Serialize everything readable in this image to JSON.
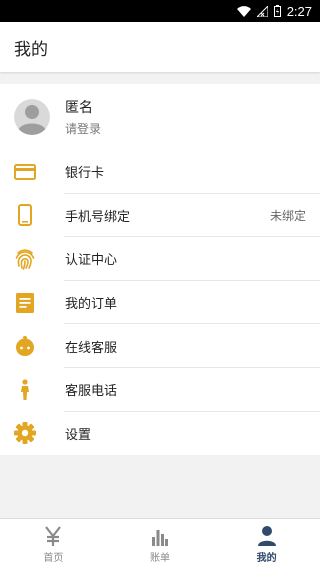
{
  "status_bar": {
    "time": "2:27"
  },
  "header": {
    "title": "我的"
  },
  "profile": {
    "name": "匿名",
    "subtitle": "请登录"
  },
  "menu": [
    {
      "label": "银行卡",
      "value": "",
      "icon": "bank-card-icon"
    },
    {
      "label": "手机号绑定",
      "value": "未绑定",
      "icon": "phone-icon"
    },
    {
      "label": "认证中心",
      "value": "",
      "icon": "fingerprint-icon"
    },
    {
      "label": "我的订单",
      "value": "",
      "icon": "order-icon"
    },
    {
      "label": "在线客服",
      "value": "",
      "icon": "customer-service-icon"
    },
    {
      "label": "客服电话",
      "value": "",
      "icon": "person-icon"
    },
    {
      "label": "设置",
      "value": "",
      "icon": "gear-icon"
    }
  ],
  "tabs": [
    {
      "label": "首页",
      "icon": "yen-icon",
      "active": false
    },
    {
      "label": "账单",
      "icon": "bar-chart-icon",
      "active": false
    },
    {
      "label": "我的",
      "icon": "user-icon",
      "active": true
    }
  ],
  "colors": {
    "accent": "#e3a622",
    "tab_active": "#2f4a6b",
    "tab_inactive": "#8a8a8a"
  }
}
